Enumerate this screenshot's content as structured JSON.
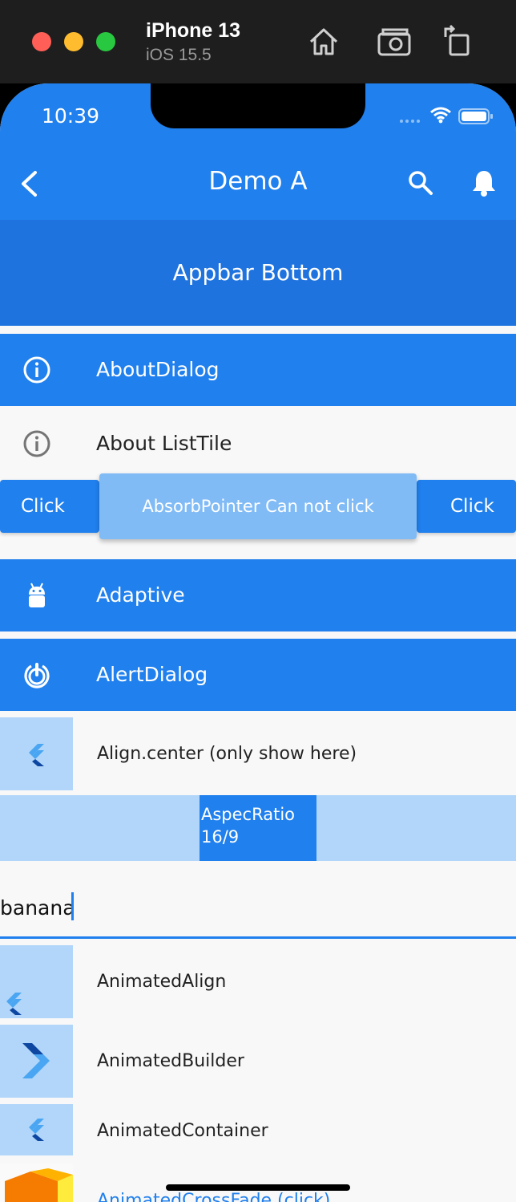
{
  "simulator": {
    "device_name": "iPhone 13",
    "os_version": "iOS 15.5",
    "icons": [
      "home-icon",
      "screenshot-icon",
      "rotate-icon"
    ]
  },
  "status_bar": {
    "time": "10:39",
    "icons": [
      "wifi-icon",
      "battery-icon"
    ]
  },
  "appbar": {
    "title": "Demo A",
    "bottom_label": "Appbar Bottom",
    "icons": [
      "back-icon",
      "search-icon",
      "bell-icon"
    ]
  },
  "list": {
    "about_dialog": "AboutDialog",
    "about_listtile": "About ListTile",
    "absorb": {
      "left_button": "Click",
      "center_button": "AbsorbPointer Can not click",
      "right_button": "Click"
    },
    "adaptive": "Adaptive",
    "alert_dialog": "AlertDialog",
    "align_center": "Align.center (only show here)",
    "aspect_line1": "AspecRatio",
    "aspect_line2": "16/9",
    "input_value": "banana",
    "animated_align": "AnimatedAlign",
    "animated_builder": "AnimatedBuilder",
    "animated_container": "AnimatedContainer",
    "animated_crossfade": "AnimatedCrossFade (click)"
  },
  "colors": {
    "primary": "#2080ed",
    "appbar_bottom": "#1f73de",
    "light_blue": "#b2d6f9"
  }
}
